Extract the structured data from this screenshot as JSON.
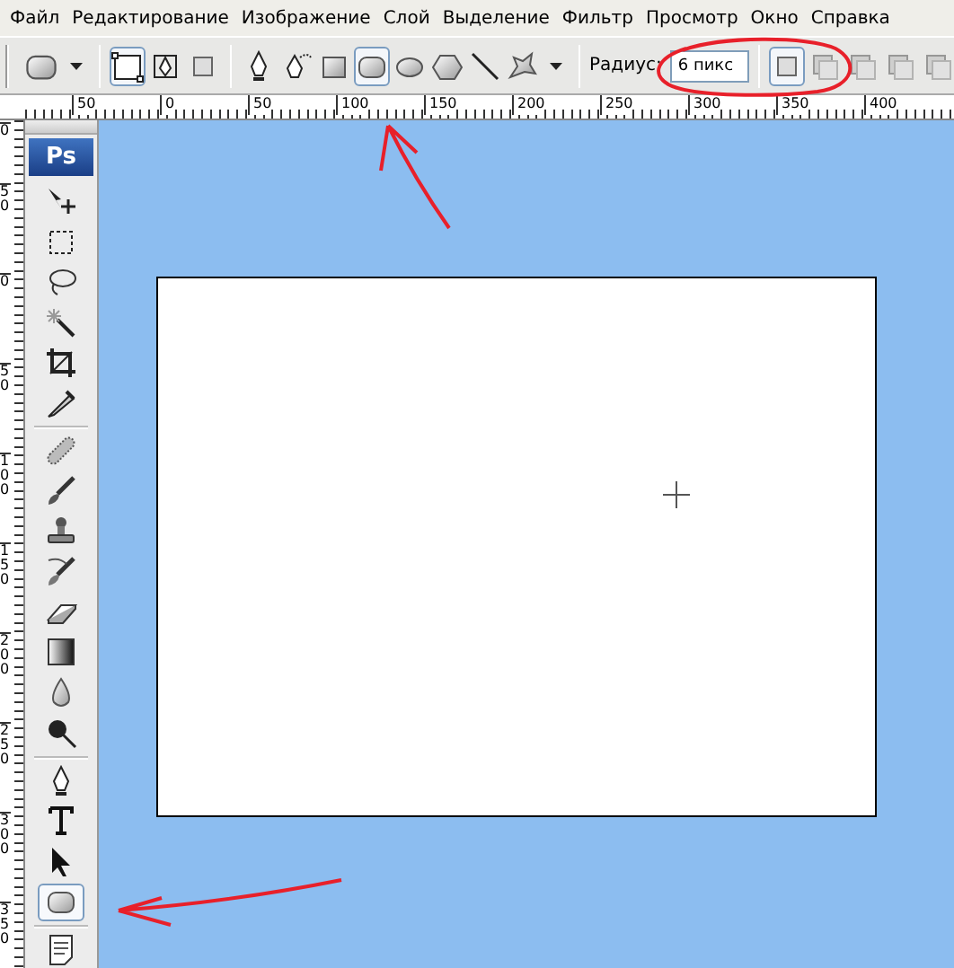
{
  "menu": [
    "Файл",
    "Редактирование",
    "Изображение",
    "Слой",
    "Выделение",
    "Фильтр",
    "Просмотр",
    "Окно",
    "Справка"
  ],
  "options_bar": {
    "path_modes": [
      {
        "selected": true
      },
      {
        "selected": false
      },
      {
        "selected": false
      }
    ],
    "shape_tools": [
      {
        "selected": false
      },
      {
        "selected": false
      },
      {
        "selected": false
      },
      {
        "selected": true
      },
      {
        "selected": false
      },
      {
        "selected": false
      },
      {
        "selected": false
      },
      {
        "selected": false
      }
    ],
    "radius": {
      "label": "Радиус:",
      "value": "6 пикс"
    },
    "combine_modes": [
      {
        "selected": true
      },
      {
        "selected": false
      },
      {
        "selected": false
      },
      {
        "selected": false
      },
      {
        "selected": false
      }
    ]
  },
  "rulers": {
    "horizontal": [
      "50",
      "0",
      "50",
      "100",
      "150",
      "200",
      "250",
      "300",
      "350",
      "400"
    ],
    "vertical": [
      "0",
      "50",
      "0",
      "50",
      "100",
      "150",
      "200",
      "250",
      "300",
      "350"
    ]
  },
  "toolbox": {
    "logo": "Ps",
    "tools": [
      {
        "selected": false
      },
      {
        "selected": false
      },
      {
        "selected": false
      },
      {
        "selected": false
      },
      {
        "selected": false
      },
      {
        "selected": false
      },
      {
        "selected": false
      },
      {
        "selected": false
      },
      {
        "selected": false
      },
      {
        "selected": false
      },
      {
        "selected": false
      },
      {
        "selected": false
      },
      {
        "selected": false
      },
      {
        "selected": false
      },
      {
        "selected": false
      },
      {
        "selected": false
      },
      {
        "selected": false
      },
      {
        "selected": true
      },
      {
        "selected": false
      }
    ]
  }
}
